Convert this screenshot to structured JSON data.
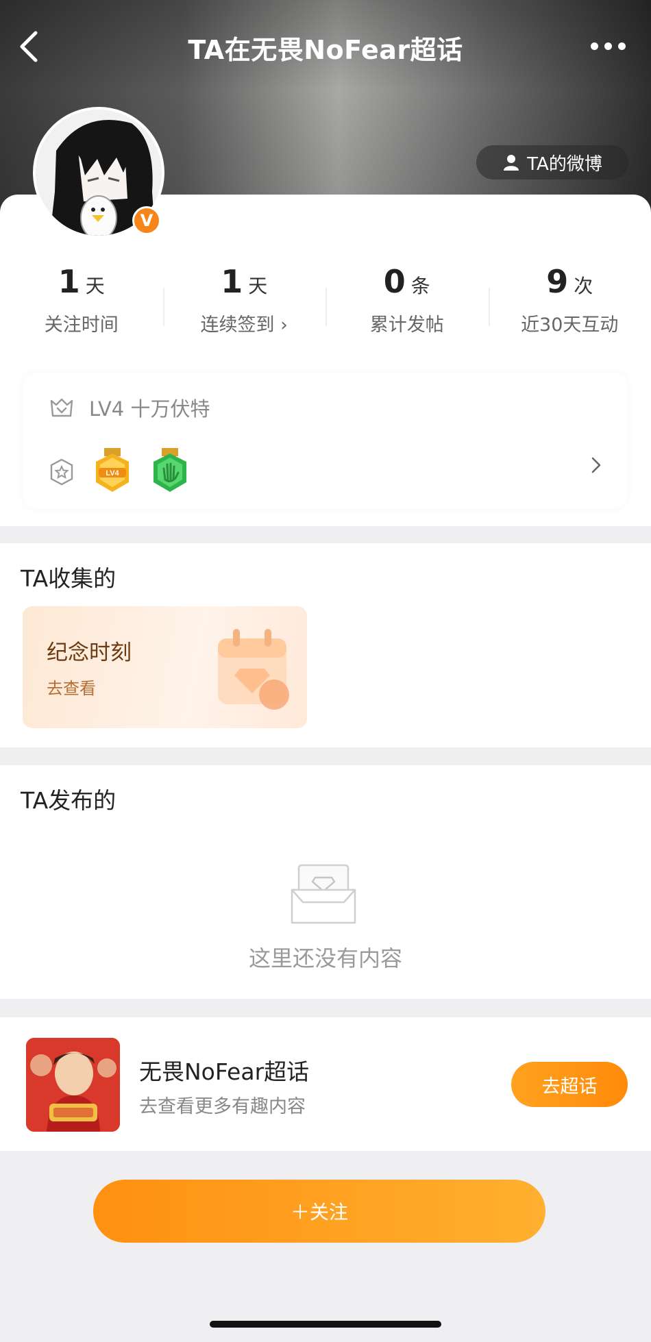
{
  "header": {
    "title": "TA在无畏NoFear超话",
    "back_icon": "chevron-left-icon",
    "more_icon": "more-dots-icon",
    "weibo_button": "TA的微博",
    "weibo_icon": "user-icon"
  },
  "profile": {
    "verified_badge": "V",
    "stats": [
      {
        "value": "1",
        "unit": "天",
        "label": "关注时间"
      },
      {
        "value": "1",
        "unit": "天",
        "label": "连续签到 ›"
      },
      {
        "value": "0",
        "unit": "条",
        "label": "累计发帖"
      },
      {
        "value": "9",
        "unit": "次",
        "label": "近30天互动"
      }
    ],
    "level_text": "LV4 十万伏特",
    "level_icon": "crown-icon",
    "medal_icon": "badge-icon",
    "medals": [
      "lv4-medal",
      "wave-hand-medal"
    ]
  },
  "collected": {
    "title": "TA收集的",
    "card_title": "纪念时刻",
    "card_link": "去查看"
  },
  "published": {
    "title": "TA发布的",
    "empty_text": "这里还没有内容"
  },
  "supertopic": {
    "name": "无畏NoFear超话",
    "subtitle": "去查看更多有趣内容",
    "button": "去超话"
  },
  "follow_button": "＋关注",
  "colors": {
    "accent": "#ff9010",
    "verified": "#f7861a",
    "medal_gold": "#f5b21c",
    "medal_green": "#3ec45a"
  }
}
